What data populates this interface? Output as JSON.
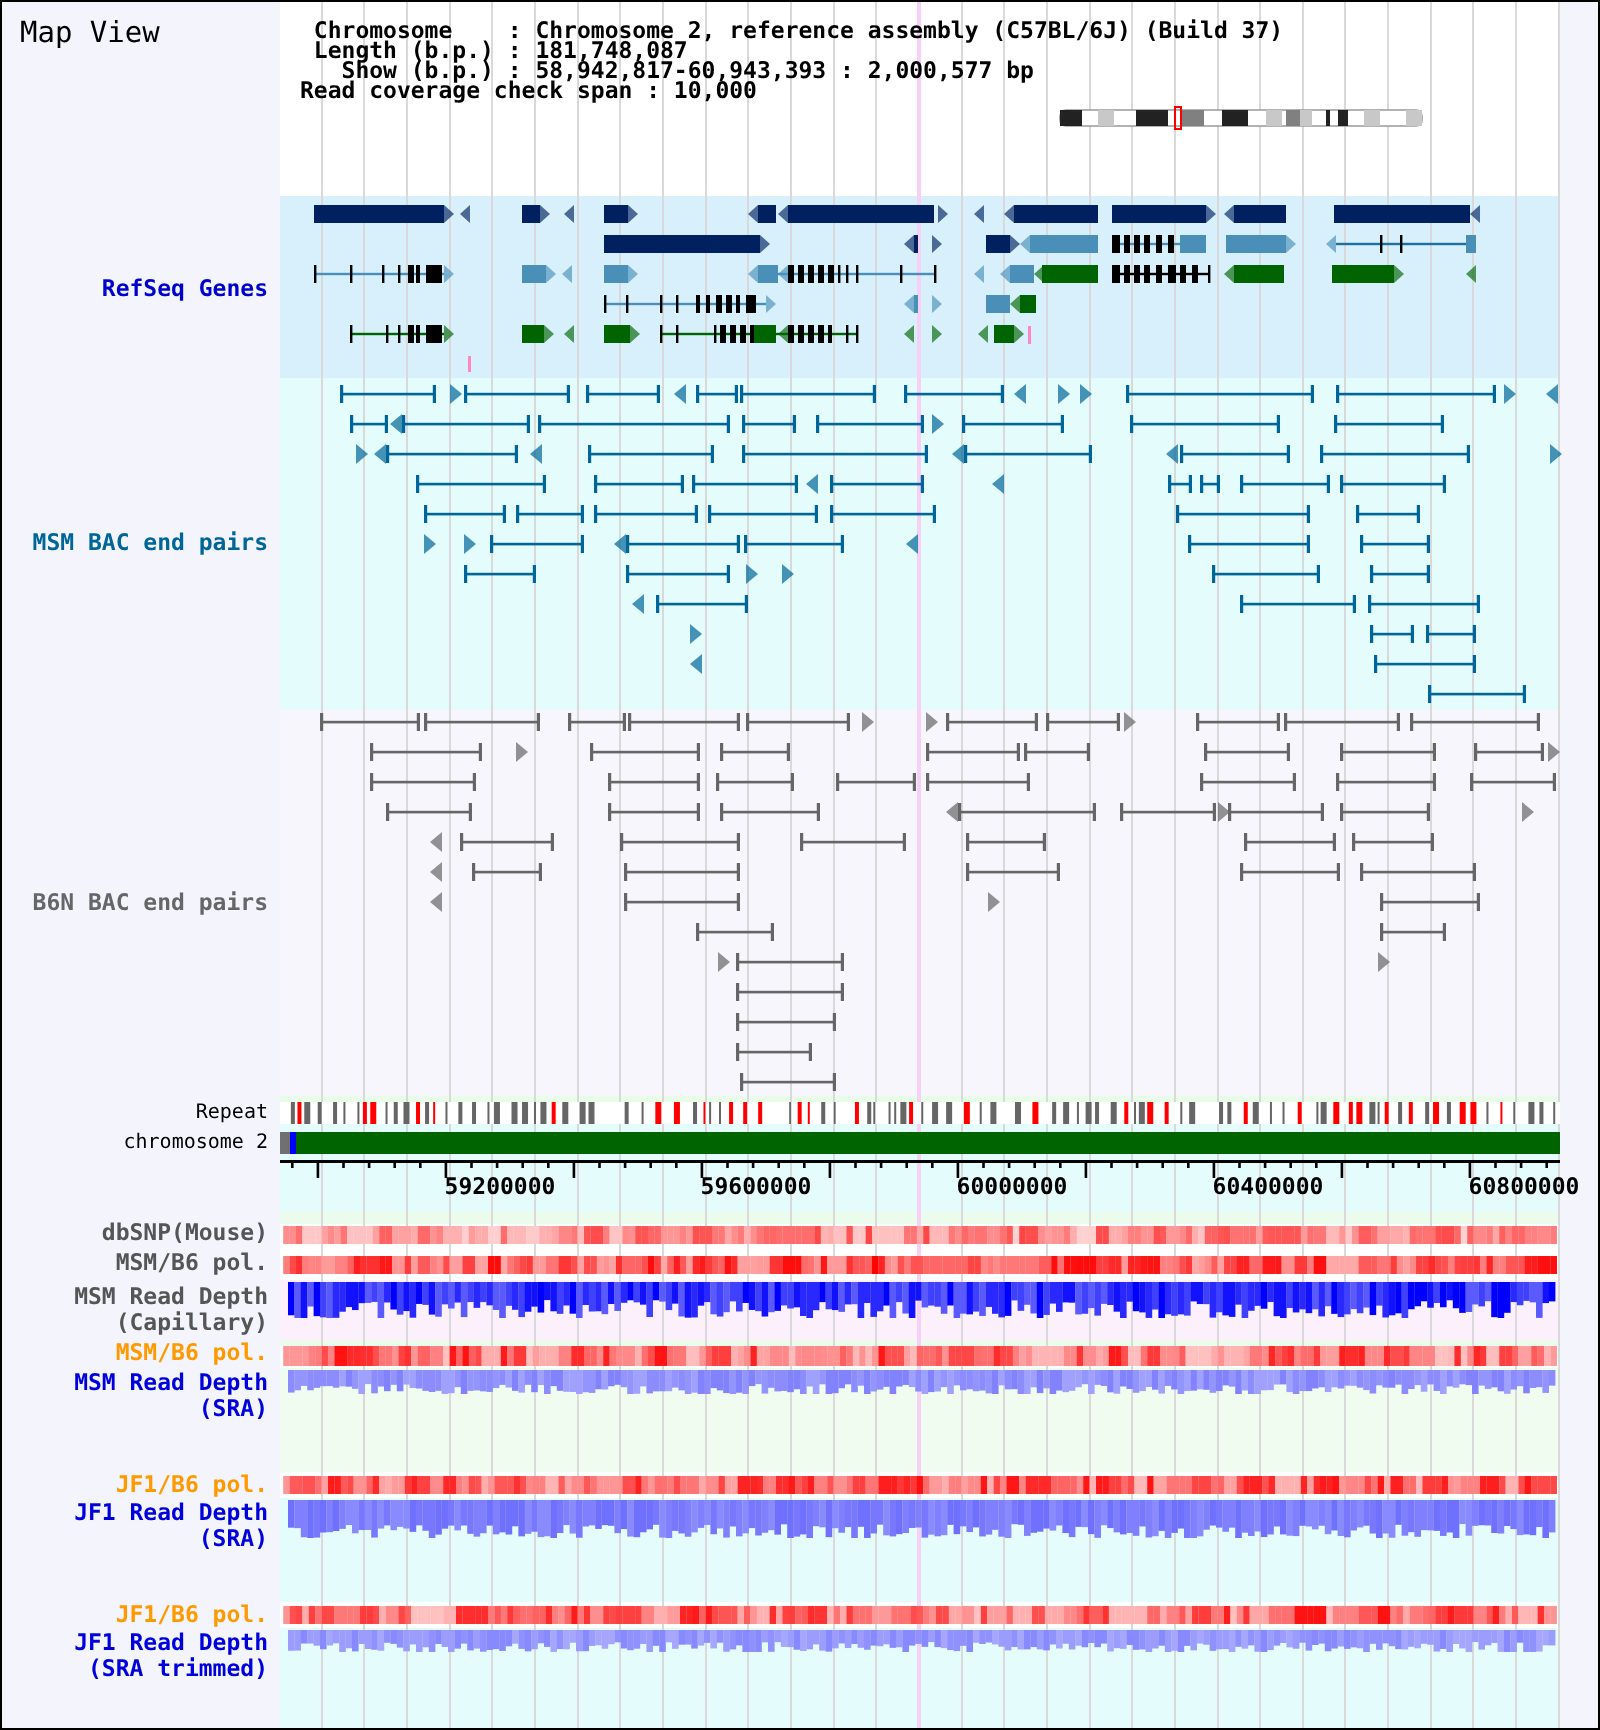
{
  "header": {
    "title": "Map View",
    "info_lines": [
      "Chromosome    : Chromosome 2, reference assembly (C57BL/6J) (Build 37)",
      "Length (b.p.) : 181,748,087",
      "Show (b.p.) : 58,942,817-60,943,393 : 2,000,577 bp",
      "Read coverage check span : 10,000"
    ]
  },
  "tracks": [
    {
      "kind": "genes",
      "label": "RefSeq Genes",
      "color": "#0000cc"
    },
    {
      "kind": "bac_pairs",
      "label": "MSM BAC end pairs",
      "color": "#006699"
    },
    {
      "kind": "bac_pairs",
      "label": "B6N BAC end pairs",
      "color": "#666666"
    },
    {
      "kind": "repeat",
      "label": "Repeat",
      "color": "#000000"
    },
    {
      "kind": "chromosome",
      "label": "chromosome 2",
      "color": "#000000"
    }
  ],
  "axis": {
    "labels": [
      "59200000",
      "59600000",
      "60000000",
      "60400000",
      "60800000"
    ]
  },
  "data_tracks": [
    {
      "kind": "heatmap",
      "label": "dbSNP(Mouse)",
      "color": "#555555"
    },
    {
      "kind": "heatmap",
      "label": "MSM/B6 pol.",
      "color": "#555555"
    },
    {
      "kind": "depth",
      "label": "MSM Read Depth (Capillary)",
      "color": "#555555"
    },
    {
      "kind": "heatmap",
      "label": "MSM/B6 pol.",
      "color": "#ff9900"
    },
    {
      "kind": "depth",
      "label": "MSM Read Depth (SRA)",
      "color": "#0000dd"
    },
    {
      "kind": "heatmap",
      "label": "JF1/B6 pol.",
      "color": "#ff9900"
    },
    {
      "kind": "depth",
      "label": "JF1 Read Depth (SRA)",
      "color": "#0000dd"
    },
    {
      "kind": "heatmap",
      "label": "JF1/B6 pol.",
      "color": "#ff9900"
    },
    {
      "kind": "depth",
      "label": "JF1 Read Depth (SRA trimmed)",
      "color": "#0000dd"
    }
  ]
}
